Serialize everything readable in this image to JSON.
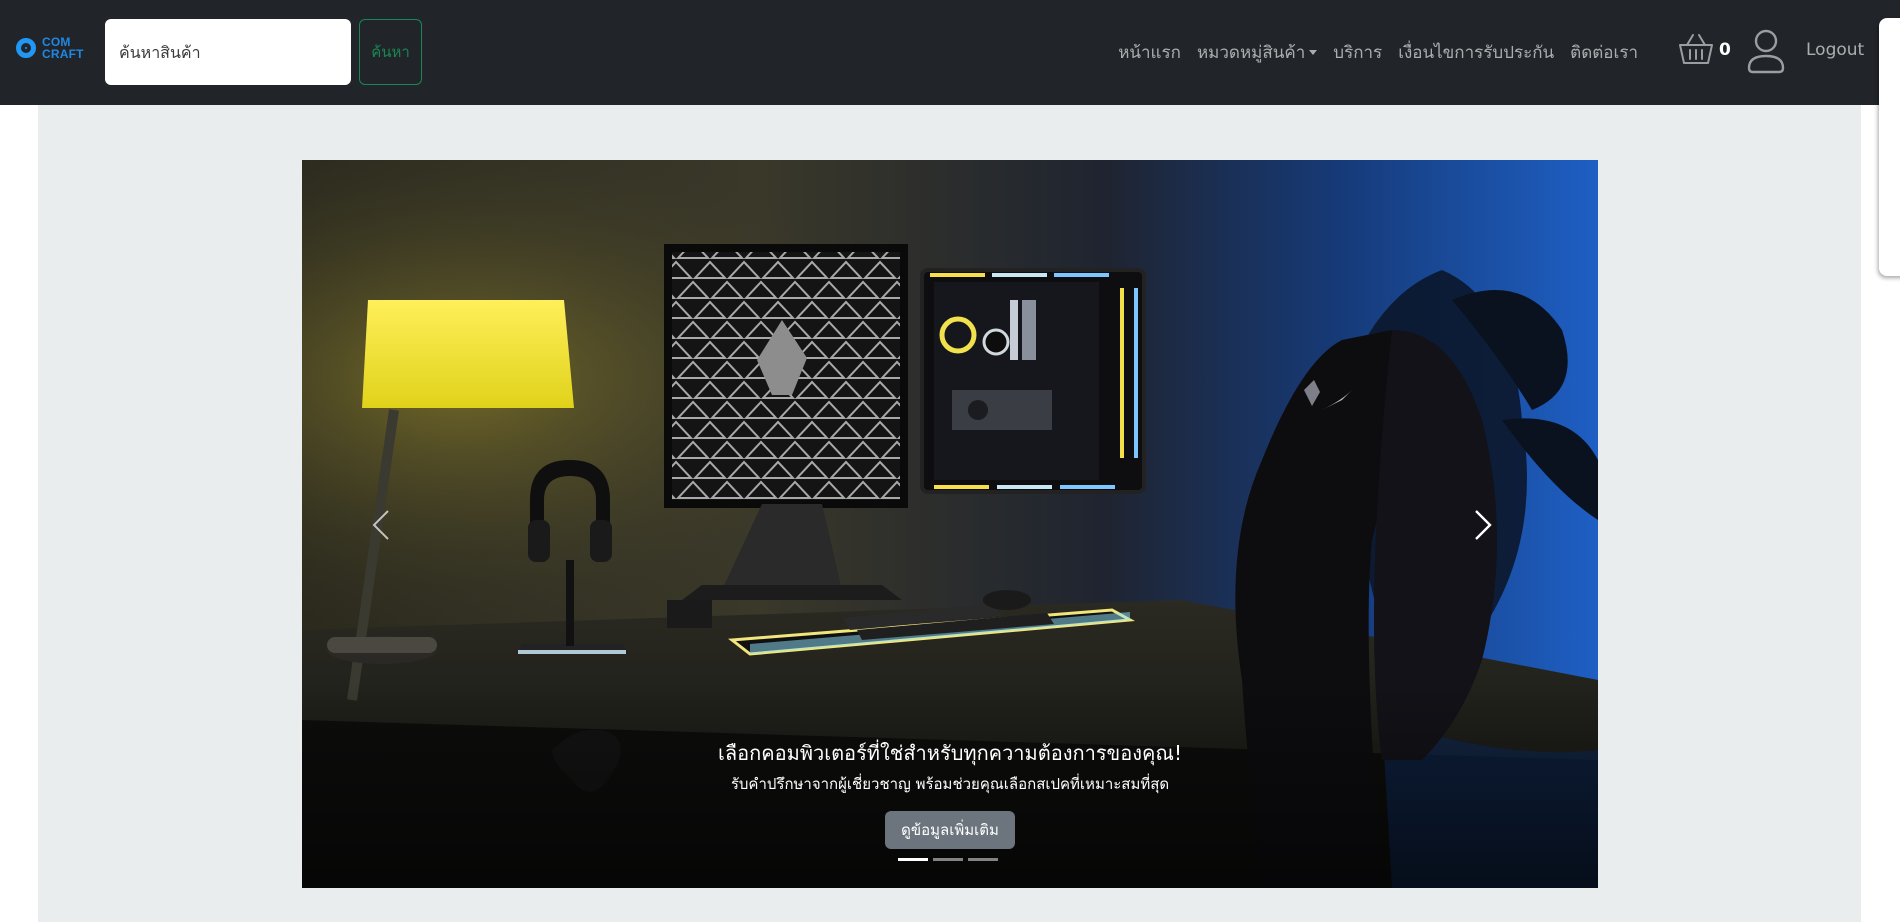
{
  "brand": {
    "logo_line1": "COM",
    "logo_line2": "CRAFT"
  },
  "search": {
    "placeholder": "ค้นหาสินค้า",
    "button_label": "ค้นหา"
  },
  "nav": {
    "items": [
      {
        "label": "หน้าแรก"
      },
      {
        "label": "หมวดหมู่สินค้า",
        "dropdown": true
      },
      {
        "label": "บริการ"
      },
      {
        "label": "เงื่อนไขการรับประกัน"
      },
      {
        "label": "ติดต่อเรา"
      }
    ],
    "cart_count": "0",
    "logout_label": "Logout"
  },
  "carousel": {
    "caption_title": "เลือกคอมพิวเตอร์ที่ใช่สำหรับทุกความต้องการของคุณ!",
    "caption_subtitle": "รับคำปรึกษาจากผู้เชี่ยวชาญ พร้อมช่วยคุณเลือกสเปคที่เหมาะสมที่สุด",
    "button_label": "ดูข้อมูลเพิ่มเติม",
    "slide_count": 3,
    "active_slide": 1
  },
  "colors": {
    "navbar_bg": "#212529",
    "brand_blue": "#1e88e5",
    "search_button_green": "#198754",
    "page_bg": "#e9edee",
    "caption_button_gray": "#6c757d"
  },
  "icons": {
    "cart": "basket-icon",
    "user": "user-icon",
    "prev": "chevron-left-icon",
    "next": "chevron-right-icon"
  }
}
